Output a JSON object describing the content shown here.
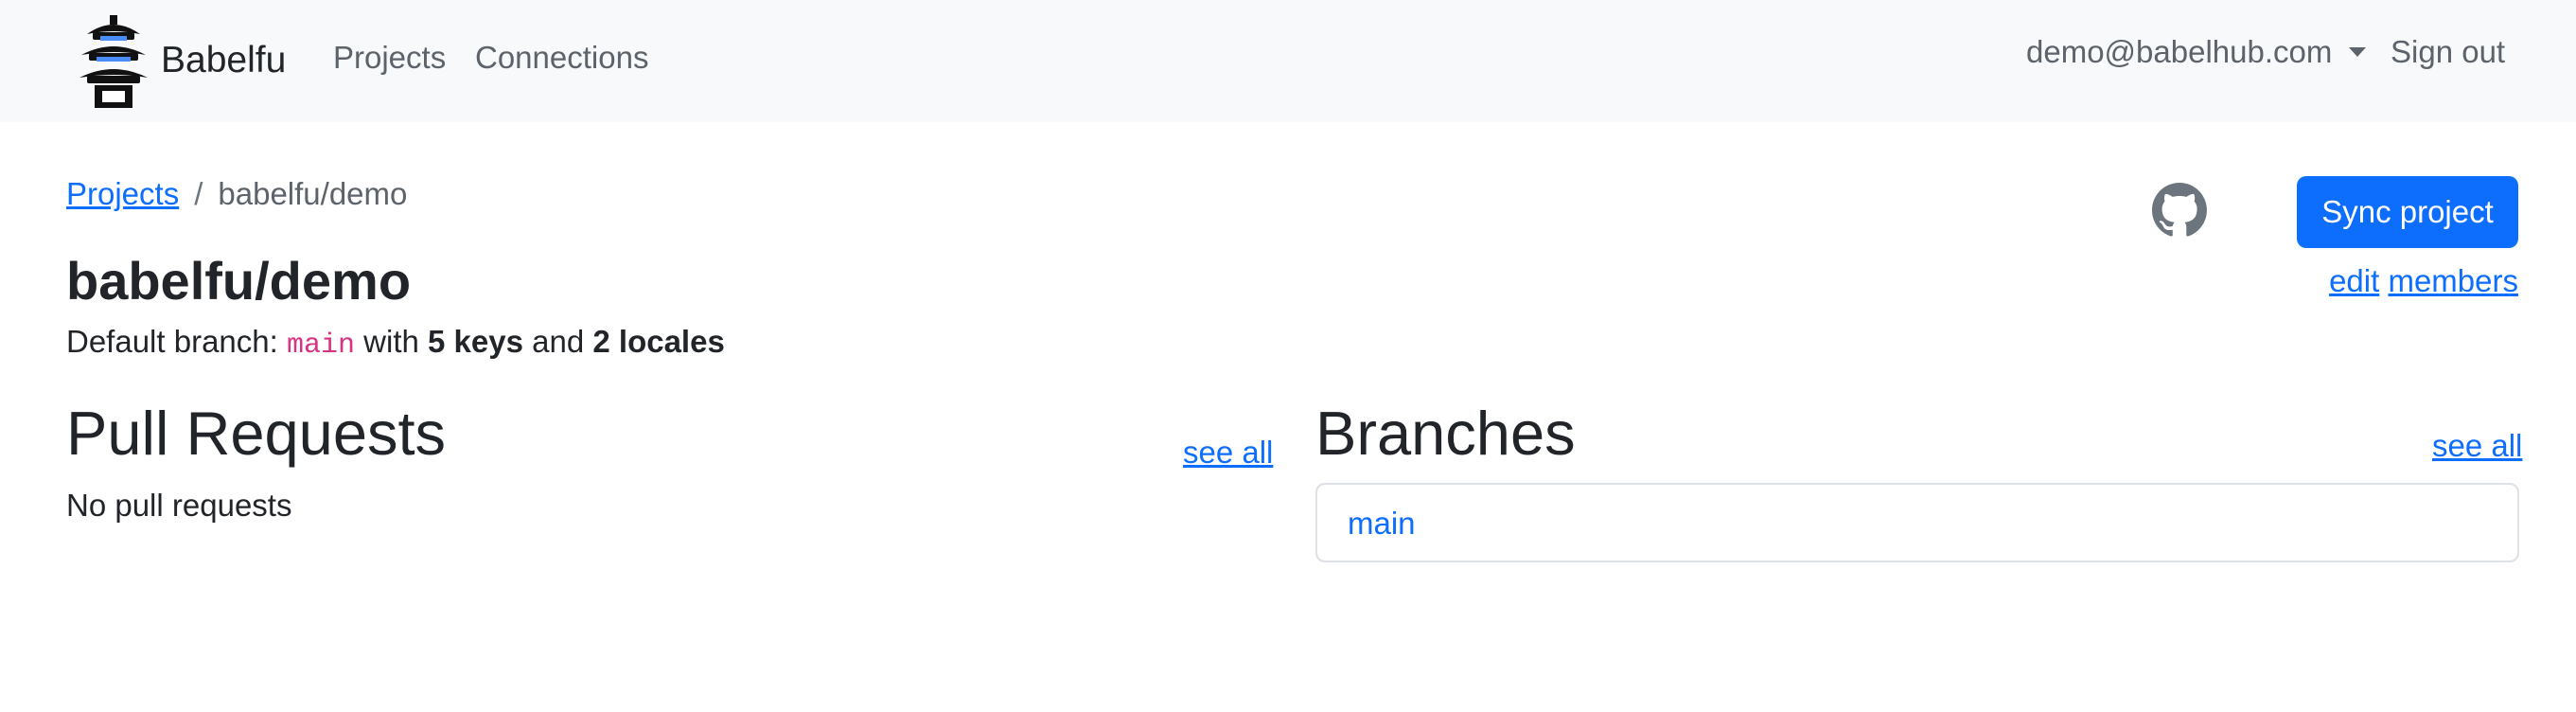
{
  "nav": {
    "brand": "Babelfu",
    "links": [
      "Projects",
      "Connections"
    ],
    "user_email": "demo@babelhub.com",
    "sign_out": "Sign out"
  },
  "breadcrumb": {
    "parent": "Projects",
    "separator": "/",
    "current": "babelfu/demo"
  },
  "project": {
    "title": "babelfu/demo",
    "default_branch_prefix": "Default branch:",
    "default_branch": "main",
    "with_text": "with",
    "keys": "5 keys",
    "and_text": "and",
    "locales": "2 locales"
  },
  "actions": {
    "sync_label": "Sync project",
    "edit_label": "edit",
    "members_label": "members",
    "github_icon": "github-icon"
  },
  "pull_requests": {
    "heading": "Pull Requests",
    "see_all": "see all",
    "empty": "No pull requests"
  },
  "branches": {
    "heading": "Branches",
    "see_all": "see all",
    "items": [
      "main"
    ]
  },
  "colors": {
    "primary": "#0d6efd",
    "navbar_bg": "#f8f9fa",
    "code": "#d63384",
    "muted": "#5c636a"
  }
}
